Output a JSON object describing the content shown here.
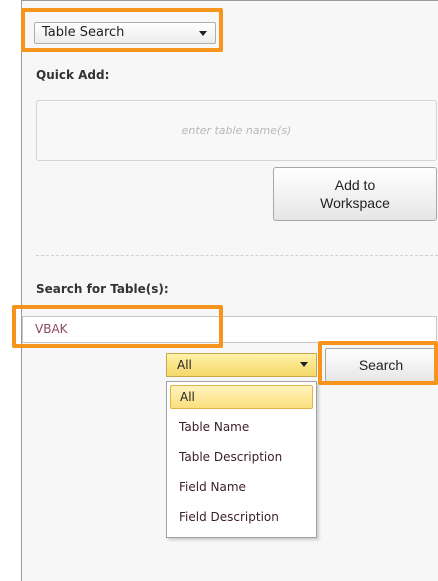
{
  "mode_select": {
    "value": "Table Search"
  },
  "quick_add": {
    "label": "Quick Add:",
    "placeholder": "enter table name(s)",
    "add_button_label": "Add to Workspace"
  },
  "search": {
    "label": "Search for Table(s):",
    "input_value": "VBAK",
    "filter_value": "All",
    "button_label": "Search",
    "options": [
      "All",
      "Table Name",
      "Table Description",
      "Field Name",
      "Field Description"
    ],
    "selected_option": "All"
  },
  "colors": {
    "highlight": "#f7941d",
    "dropdown_selected": "#fbdf7e"
  }
}
